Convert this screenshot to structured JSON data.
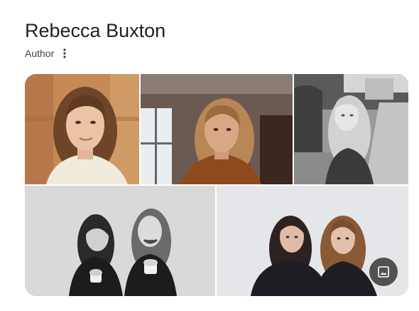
{
  "header": {
    "title": "Rebecca Buxton",
    "subtitle": "Author"
  },
  "icons": {
    "more": "more-vert-icon",
    "image": "image-icon"
  },
  "gallery": {
    "image_count": 5
  },
  "colors": {
    "title": "#202124",
    "subtitle": "#3c4043",
    "image_button_bg": "#303030"
  }
}
